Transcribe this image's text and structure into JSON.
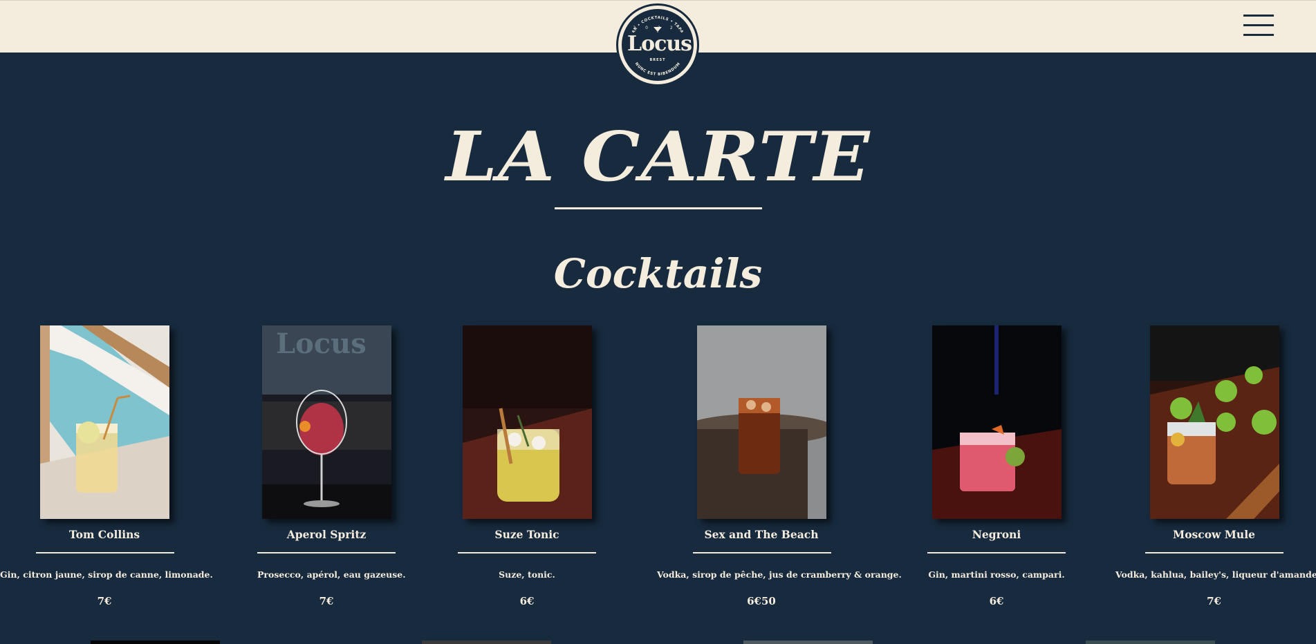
{
  "header": {
    "logo": {
      "name": "Locus",
      "tagline_top": "BAR • COCKTAILS • TAPAS",
      "year_left": "20",
      "year_right": "22",
      "city": "BREST",
      "motto": "NUNC EST BIBENDUM"
    },
    "menu_icon": "hamburger-menu-icon"
  },
  "page": {
    "title": "LA CARTE",
    "section_title": "Cocktails"
  },
  "cocktails": [
    {
      "name": "Tom Collins",
      "description": "Gin, citron jaune, sirop de canne, limonade.",
      "price": "7€"
    },
    {
      "name": "Aperol Spritz",
      "description": "Prosecco, apérol, eau gazeuse.",
      "price": "7€"
    },
    {
      "name": "Suze Tonic",
      "description": "Suze, tonic.",
      "price": "6€"
    },
    {
      "name": "Sex and The Beach",
      "description": "Vodka, sirop de pêche, jus de cramberry & orange.",
      "price": "6€50"
    },
    {
      "name": "Negroni",
      "description": "Gin, martini rosso, campari.",
      "price": "6€"
    },
    {
      "name": "Moscow Mule",
      "description": "Vodka, kahlua, bailey's, liqueur d'amande.",
      "price": "7€"
    }
  ],
  "colors": {
    "background": "#172a3e",
    "cream": "#f4ecdd"
  }
}
